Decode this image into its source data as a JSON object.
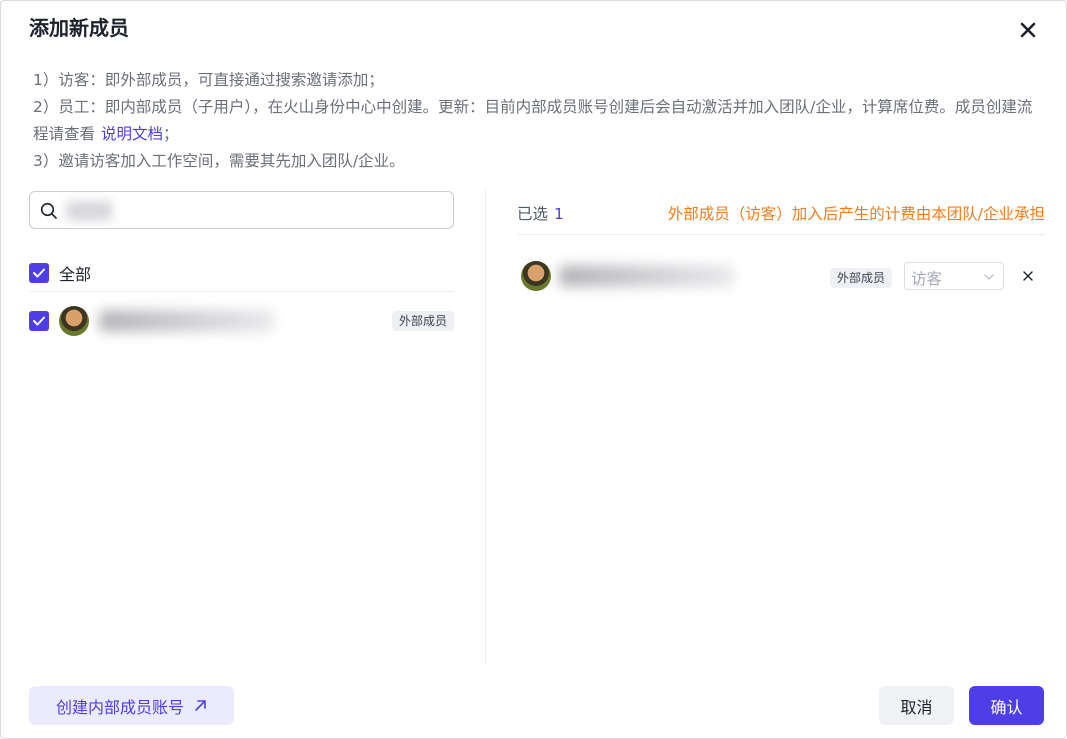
{
  "dialog": {
    "title": "添加新成员",
    "close_icon": "close-icon"
  },
  "notes": {
    "line1": "1）访客：即外部成员，可直接通过搜索邀请添加；",
    "line2": "2）员工：即内部成员（子用户），在火山身份中心中创建。更新：目前内部成员账号创建后会自动激活并加入团队/企业，计算席位费。成员创建流程请查看",
    "line2_link": "说明文档",
    "line2_end": "；",
    "line3": "3）邀请访客加入工作空间，需要其先加入团队/企业。"
  },
  "search": {
    "icon": "search-icon",
    "value": ""
  },
  "left": {
    "select_all_label": "全部",
    "select_all_checked": true,
    "members": [
      {
        "checked": true,
        "tag": "外部成员"
      }
    ]
  },
  "right": {
    "selected_label": "已选",
    "selected_count": "1",
    "billing_notice": "外部成员（访客）加入后产生的计费由本团队/企业承担",
    "selected": [
      {
        "tag": "外部成员",
        "role": "访客"
      }
    ]
  },
  "footer": {
    "create_label": "创建内部成员账号",
    "create_icon": "external-arrow-icon",
    "cancel_label": "取消",
    "confirm_label": "确认"
  },
  "colors": {
    "accent": "#4e3ee8",
    "warning": "#f57c1f",
    "muted_text": "#6b6f78"
  }
}
